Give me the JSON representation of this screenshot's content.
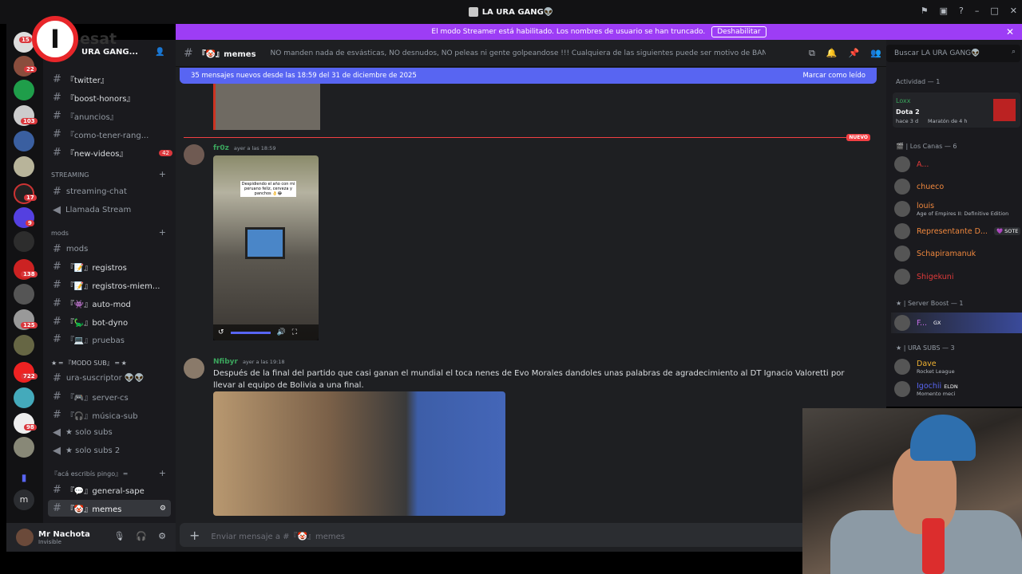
{
  "window": {
    "title": "LA URA GANG👽"
  },
  "banner": {
    "text": "El modo Streamer está habilitado. Los nombres de usuario se han truncado.",
    "button": "Deshabilitar"
  },
  "overlay_logo": {
    "letter": "I",
    "text": "esat"
  },
  "server": {
    "name": "URA GANG..."
  },
  "servers": {
    "badges": [
      "15",
      "22",
      "103",
      "17",
      "9",
      "138",
      "125",
      "722",
      "98"
    ]
  },
  "channels": {
    "items": [
      {
        "label": "『twitter』"
      },
      {
        "label": "『boost-honors』"
      },
      {
        "label": "『anuncios』"
      },
      {
        "label": "『como-tener-rang..."
      },
      {
        "label": "『new-videos』",
        "badge": "42"
      }
    ],
    "streaming_cat": "STREAMING",
    "streaming_chat": "streaming-chat",
    "llamada": "Llamada Stream",
    "mods_cat": "mods",
    "mods_ch": "mods",
    "registros": "『📝』registros",
    "registros_miem": "『📝』registros-miem...",
    "automod": "『👾』auto-mod",
    "botdyno": "『🦕』bot-dyno",
    "pruebas": "『💻』pruebas",
    "modo_sub_cat": "★ ═ 『MODO SUB』 ═ ★",
    "ura_suscriptor": "ura-suscriptor 👽👽",
    "server_cs": "『🎮』server-cs",
    "musica_sub": "『🎧』música-sub",
    "solo_subs": "★ solo subs",
    "solo_subs2": "★ solo subs 2",
    "aca_cat": "『acá escribís pingo』 ═",
    "general_sape": "『💬』general-sape",
    "memes": "『🤡』memes"
  },
  "user": {
    "name": "Mr Nachota",
    "status": "Invisible"
  },
  "chat": {
    "channel_name": "『🤡』memes",
    "topic": "NO manden nada de esvásticas, NO desnudos, NO peleas ni gente golpeandose !!! Cualquiera de las siguientes puede ser motivo de BAN, cuiden el stream!",
    "newbar_text": "35 mensajes nuevos desde las 18:59 del 31 de diciembre de 2025",
    "newbar_action": "Marcar como leído",
    "new_label": "NUEVO",
    "msg1": {
      "author": "fr0z",
      "time": "ayer a las 18:59",
      "caption": "Despidiendo el año con mi peruano feliz, cerveza y panchos 👌😂"
    },
    "msg2": {
      "author": "Nfibyr",
      "time": "ayer a las 19:18",
      "text": "Después de la final del partido que casi ganan el mundial el toca nenes de Evo Morales dandoles unas palabras de agradecimiento al DT Ignacio Valoretti por llevar al equipo de Bolivia a una final."
    },
    "input_placeholder": "Enviar mensaje a #『🤡』memes"
  },
  "members": {
    "search_placeholder": "Buscar LA URA GANG👽",
    "activity_header": "Actividad — 1",
    "activity": {
      "user": "Loxx",
      "game": "Dota 2",
      "when": "hace 3 d",
      "detail": "Maratón de 4 h"
    },
    "cat1": "🎬 | Los Canas — 6",
    "list1": [
      {
        "name": "A...",
        "color": "#e03a3a"
      },
      {
        "name": "chueco",
        "color": "#f0883e"
      },
      {
        "name": "louis",
        "color": "#f0883e",
        "sub": "Age of Empires II: Definitive Edition"
      },
      {
        "name": "Representante D...",
        "color": "#f0883e",
        "tag": "💜 SOTE"
      },
      {
        "name": "Schapiramanuk",
        "color": "#f0883e"
      },
      {
        "name": "Shigekuni",
        "color": "#e03a3a"
      }
    ],
    "cat2": "★ | Server Boost — 1",
    "boost_user": "F...",
    "boost_tag": "GX",
    "cat3": "★ | URA SUBS — 3",
    "list3": [
      {
        "name": "Dave",
        "color": "#f0b232",
        "sub": "Rocket League"
      },
      {
        "name": "Igochii",
        "color": "#5865f2",
        "tag": "ELDN",
        "sub": "Momento meci"
      }
    ]
  }
}
